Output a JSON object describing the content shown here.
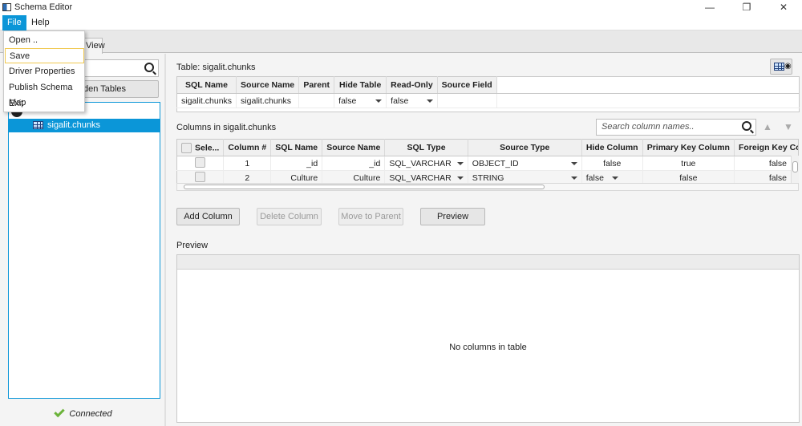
{
  "window": {
    "title": "Schema Editor",
    "controls": [
      "—",
      "❐",
      "✕"
    ]
  },
  "menubar": {
    "file": "File",
    "help": "Help"
  },
  "file_menu": {
    "items": [
      "Open ..",
      "Save",
      "Driver Properties",
      "Publish Schema Map",
      "Exit"
    ]
  },
  "tab": {
    "label": "View"
  },
  "left": {
    "hidden_tables_label": "den Tables",
    "tree_selected": "sigalit.chunks",
    "status": "Connected"
  },
  "table_panel": {
    "title": "Table: sigalit.chunks",
    "headers": [
      "SQL Name",
      "Source Name",
      "Parent",
      "Hide Table",
      "Read-Only",
      "Source Field"
    ],
    "row": {
      "sql_name": "sigalit.chunks",
      "source_name": "sigalit.chunks",
      "parent": "",
      "hide_table": "false",
      "read_only": "false",
      "source_field": ""
    }
  },
  "columns_panel": {
    "title": "Columns in sigalit.chunks",
    "search_placeholder": "Search column names..",
    "headers": [
      "Sele...",
      "Column #",
      "SQL Name",
      "Source Name",
      "SQL Type",
      "Source Type",
      "Hide Column",
      "Primary Key Column",
      "Foreign Key Colun"
    ],
    "rows": [
      {
        "num": "1",
        "sql_name": "_id",
        "source_name": "_id",
        "sql_type": "SQL_VARCHAR",
        "source_type": "OBJECT_ID",
        "hide": "false",
        "pk": "true",
        "fk": "false"
      },
      {
        "num": "2",
        "sql_name": "Culture",
        "source_name": "Culture",
        "sql_type": "SQL_VARCHAR",
        "source_type": "STRING",
        "hide": "false",
        "pk": "false",
        "fk": "false"
      }
    ]
  },
  "buttons": {
    "add": "Add Column",
    "delete": "Delete Column",
    "move": "Move to Parent",
    "preview": "Preview"
  },
  "preview": {
    "title": "Preview",
    "empty": "No columns in table"
  },
  "colors": {
    "accent": "#0b96d8",
    "connected": "#6bb33a"
  }
}
